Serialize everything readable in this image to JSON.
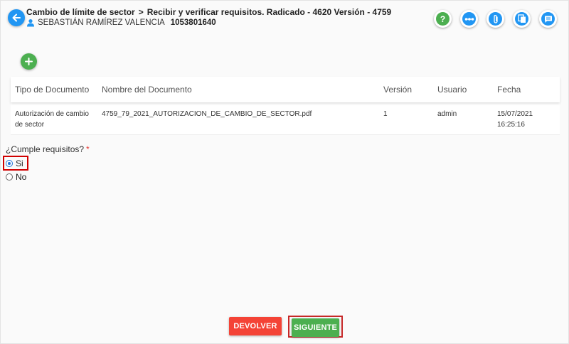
{
  "header": {
    "title_main": "Cambio de límite de sector",
    "title_sep": ">",
    "title_task": "Recibir y verificar requisitos. Radicado - 4620 Versión - 4759",
    "user_name": "SEBASTIÁN RAMÍREZ VALENCIA",
    "user_id": "1053801640",
    "back_icon": "arrow-left-icon",
    "actions": [
      {
        "icon": "help-icon",
        "color": "#4caf50"
      },
      {
        "icon": "flow-icon",
        "color": "#2196f3"
      },
      {
        "icon": "attachment-icon",
        "color": "#2196f3"
      },
      {
        "icon": "copy-icon",
        "color": "#2196f3"
      },
      {
        "icon": "comment-icon",
        "color": "#2196f3"
      }
    ]
  },
  "table": {
    "headers": {
      "tipo": "Tipo de Documento",
      "nombre": "Nombre del Documento",
      "version": "Versión",
      "usuario": "Usuario",
      "fecha": "Fecha"
    },
    "rows": [
      {
        "tipo_line1": "Autorización de cambio",
        "tipo_line2": "de sector",
        "nombre": "4759_79_2021_AUTORIZACION_DE_CAMBIO_DE_SECTOR.pdf",
        "version": "1",
        "usuario": "admin",
        "fecha_line1": "15/07/2021",
        "fecha_line2": "16:25:16"
      }
    ]
  },
  "form": {
    "question": "¿Cumple requisitos?",
    "required_mark": "*",
    "options": [
      {
        "label": "Si",
        "checked": true
      },
      {
        "label": "No",
        "checked": false
      }
    ]
  },
  "buttons": {
    "devolver": "DEVOLVER",
    "siguiente": "SIGUIENTE"
  },
  "colors": {
    "primary": "#2196f3",
    "success": "#4caf50",
    "danger": "#f44336",
    "highlight": "#d00000"
  }
}
